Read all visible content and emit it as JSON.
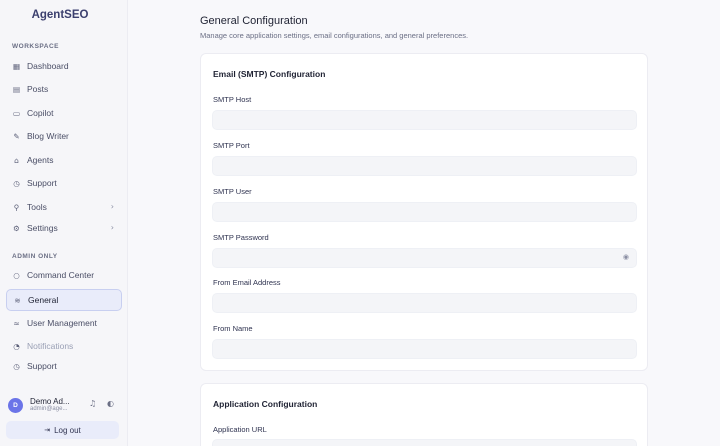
{
  "brand": "AgentSEO",
  "sidebar": {
    "workspace_label": "WORKSPACE",
    "workspace_items": [
      {
        "label": "Dashboard",
        "icon": "grid-icon"
      },
      {
        "label": "Posts",
        "icon": "document-icon"
      },
      {
        "label": "Copilot",
        "icon": "chat-icon"
      },
      {
        "label": "Blog Writer",
        "icon": "pen-icon"
      },
      {
        "label": "Agents",
        "icon": "bot-icon"
      },
      {
        "label": "Support",
        "icon": "help-icon"
      },
      {
        "label": "Tools",
        "icon": "wrench-icon",
        "chevron": "›"
      },
      {
        "label": "Settings",
        "icon": "gear-icon",
        "chevron": "›"
      }
    ],
    "admin_label": "ADMIN ONLY",
    "admin_items": [
      {
        "label": "Command Center",
        "icon": "circle-icon"
      },
      {
        "label": "General",
        "icon": "layers-icon",
        "active": true
      },
      {
        "label": "User Management",
        "icon": "users-icon"
      },
      {
        "label": "Notifications",
        "icon": "bell-icon"
      }
    ],
    "support_item": {
      "label": "Support",
      "icon": "help-icon"
    },
    "profile": {
      "initial": "D",
      "name": "Demo Ad...",
      "email": "admin@age..."
    },
    "logout_label": "Log out"
  },
  "main": {
    "title": "General Configuration",
    "subtitle": "Manage core application settings, email configurations, and general preferences.",
    "smtp_card": {
      "title": "Email (SMTP) Configuration",
      "fields": [
        {
          "label": "SMTP Host",
          "value": ""
        },
        {
          "label": "SMTP Port",
          "value": ""
        },
        {
          "label": "SMTP User",
          "value": ""
        },
        {
          "label": "SMTP Password",
          "value": ""
        },
        {
          "label": "From Email Address",
          "value": ""
        },
        {
          "label": "From Name",
          "value": ""
        }
      ]
    },
    "app_card": {
      "title": "Application Configuration",
      "fields": [
        {
          "label": "Application URL",
          "value": ""
        }
      ]
    }
  }
}
